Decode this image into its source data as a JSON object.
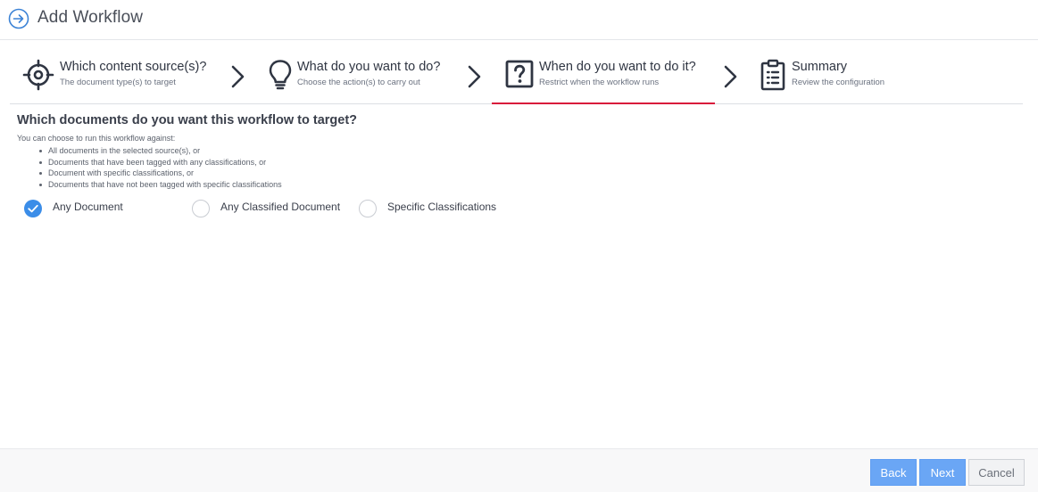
{
  "header": {
    "title": "Add Workflow",
    "icon": "arrow-right-circle-icon"
  },
  "steps": [
    {
      "title": "Which content source(s)?",
      "subtitle": "The document type(s) to target",
      "icon": "target-icon"
    },
    {
      "title": "What do you want to do?",
      "subtitle": "Choose the action(s) to carry out",
      "icon": "lightbulb-icon"
    },
    {
      "title": "When do you want to do it?",
      "subtitle": "Restrict when the workflow runs",
      "icon": "question-box-icon",
      "active": true
    },
    {
      "title": "Summary",
      "subtitle": "Review the configuration",
      "icon": "clipboard-list-icon"
    }
  ],
  "content": {
    "question": "Which documents do you want this workflow to target?",
    "intro": "You can choose to run this workflow against:",
    "bullets": [
      "All documents in the selected source(s), or",
      "Documents that have been tagged with any classifications, or",
      "Document with specific classifications, or",
      "Documents that have not been tagged with specific classifications"
    ],
    "options": [
      {
        "label": "Any Document",
        "checked": true
      },
      {
        "label": "Any Classified Document",
        "checked": false
      },
      {
        "label": "Specific Classifications",
        "checked": false
      }
    ]
  },
  "footer": {
    "back_label": "Back",
    "next_label": "Next",
    "cancel_label": "Cancel"
  },
  "colors": {
    "accent": "#3b8de8",
    "active_step": "#d9183b",
    "primary_button": "#6aa6f5"
  }
}
